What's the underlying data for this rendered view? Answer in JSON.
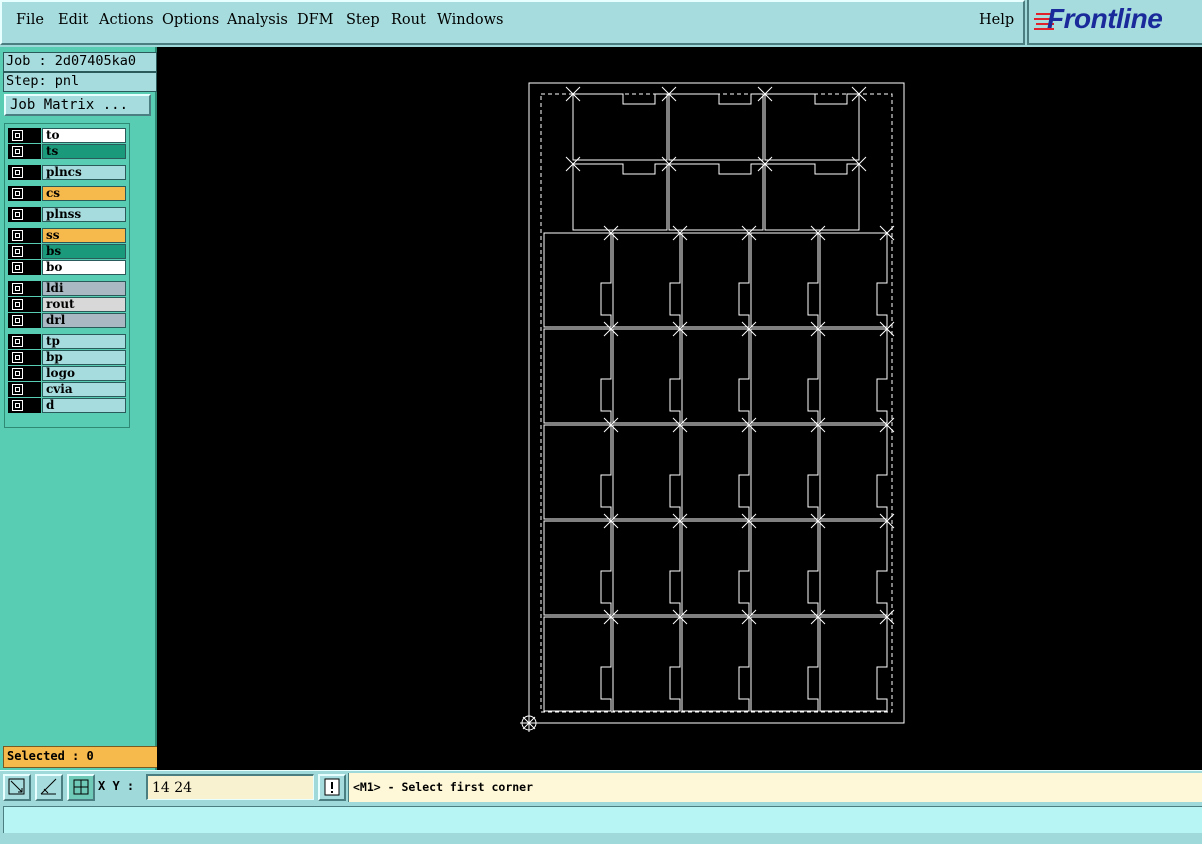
{
  "menu": {
    "items": [
      {
        "label": "File",
        "key": "F"
      },
      {
        "label": "Edit",
        "key": "E"
      },
      {
        "label": "Actions",
        "key": "A"
      },
      {
        "label": "Options",
        "key": "O"
      },
      {
        "label": "Analysis",
        "key": "A"
      },
      {
        "label": "DFM",
        "key": "D"
      },
      {
        "label": "Step",
        "key": "S"
      },
      {
        "label": "Rout",
        "key": "R"
      },
      {
        "label": "Windows",
        "key": "W"
      }
    ],
    "help": "Help"
  },
  "brand": {
    "name": "Frontline",
    "color": "#1a2a9a",
    "accent": "#e0202a"
  },
  "job": {
    "label": "Job : 2d07405ka0",
    "step": "Step: pnl"
  },
  "job_matrix": "Job Matrix ...",
  "layers": [
    {
      "name": "to",
      "color": "#ffffff"
    },
    {
      "name": "ts",
      "color": "#1a9a7a"
    },
    {
      "name": "plncs",
      "color": "#a6dcdd"
    },
    {
      "name": "cs",
      "color": "#f6b94c"
    },
    {
      "name": "plnss",
      "color": "#a6dcdd"
    },
    {
      "name": "ss",
      "color": "#f6b94c"
    },
    {
      "name": "bs",
      "color": "#1a9a7a"
    },
    {
      "name": "bo",
      "color": "#ffffff"
    },
    {
      "name": "ldi",
      "color": "#a9b8c2"
    },
    {
      "name": "rout",
      "color": "#d8d8d8"
    },
    {
      "name": "drl",
      "color": "#a9b8c2"
    },
    {
      "name": "tp",
      "color": "#a6dcdd"
    },
    {
      "name": "bp",
      "color": "#a6dcdd"
    },
    {
      "name": "logo",
      "color": "#a6dcdd"
    },
    {
      "name": "cvia",
      "color": "#a6dcdd"
    },
    {
      "name": "d",
      "color": "#a6dcdd"
    }
  ],
  "selected": "Selected : 0",
  "toolbar": {
    "xy_label": "X Y :",
    "xy_value": "14 24",
    "prompt": "<M1> - Select first corner"
  },
  "canvas_bg": "#000000",
  "icons": [
    "zoom-box-icon",
    "measure-icon",
    "snap-grid-icon",
    "warning-icon"
  ]
}
